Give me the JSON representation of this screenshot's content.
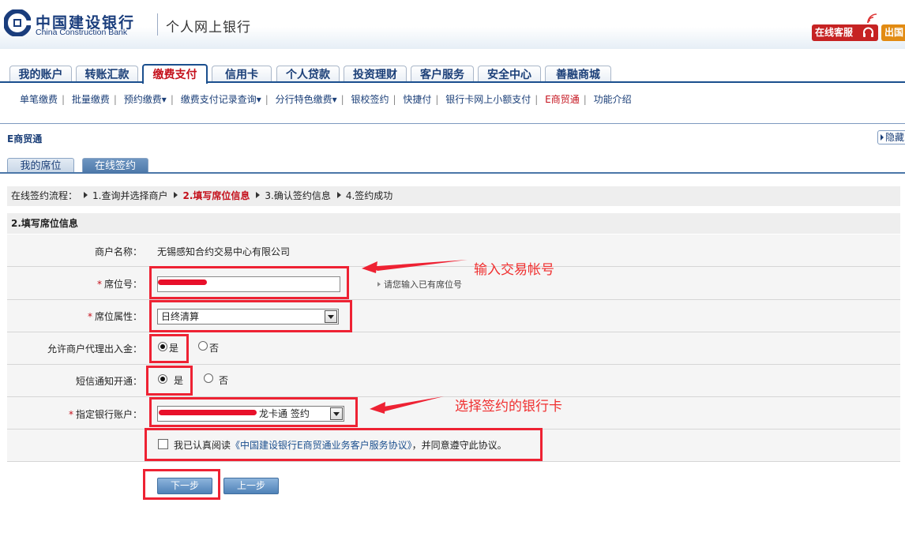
{
  "header": {
    "bank_name_cn": "中国建设银行",
    "bank_name_en": "China Construction Bank",
    "site_name": "个人网上银行",
    "service_button": "在线客服",
    "exit_button": "出国"
  },
  "main_tabs": [
    "我的账户",
    "转账汇款",
    "缴费支付",
    "信用卡",
    "个人贷款",
    "投资理财",
    "客户服务",
    "安全中心",
    "善融商城"
  ],
  "active_main_tab": "缴费支付",
  "sub_nav": [
    "单笔缴费",
    "批量缴费",
    "预约缴费▾",
    "缴费支付记录查询▾",
    "分行特色缴费▾",
    "银校签约",
    "快捷付",
    "银行卡网上小额支付",
    "E商贸通",
    "功能介绍"
  ],
  "active_sub_nav": "E商贸通",
  "section": {
    "title": "E商贸通",
    "hide_button": "隐藏"
  },
  "sub_tabs": [
    "我的席位",
    "在线签约"
  ],
  "active_sub_tab": "在线签约",
  "flow": {
    "label": "在线签约流程：",
    "steps": [
      "1.查询并选择商户",
      "2.填写席位信息",
      "3.确认签约信息",
      "4.签约成功"
    ],
    "current_step": 2
  },
  "form": {
    "heading": "2.填写席位信息",
    "merchant_label": "商户名称：",
    "merchant_value": "无锡感知合约交易中心有限公司",
    "seat_no_label": "席位号：",
    "seat_no_hint": "请您输入已有席位号",
    "seat_attr_label": "席位属性：",
    "seat_attr_value": "日终清算",
    "agent_label": "允许商户代理出入金：",
    "sms_label": "短信通知开通：",
    "yes": "是",
    "no": "否",
    "account_label": "指定银行账户：",
    "account_suffix": "龙卡通  签约",
    "required_mark": "*",
    "agree_prefix": "我已认真阅读",
    "agree_link": "《中国建设银行E商贸通业务客户服务协议》",
    "agree_suffix": "，并同意遵守此协议。",
    "next_button": "下一步",
    "prev_button": "上一步"
  },
  "annotations": {
    "input_account": "输入交易帐号",
    "choose_card": "选择签约的银行卡",
    "color": "#ee2233"
  }
}
